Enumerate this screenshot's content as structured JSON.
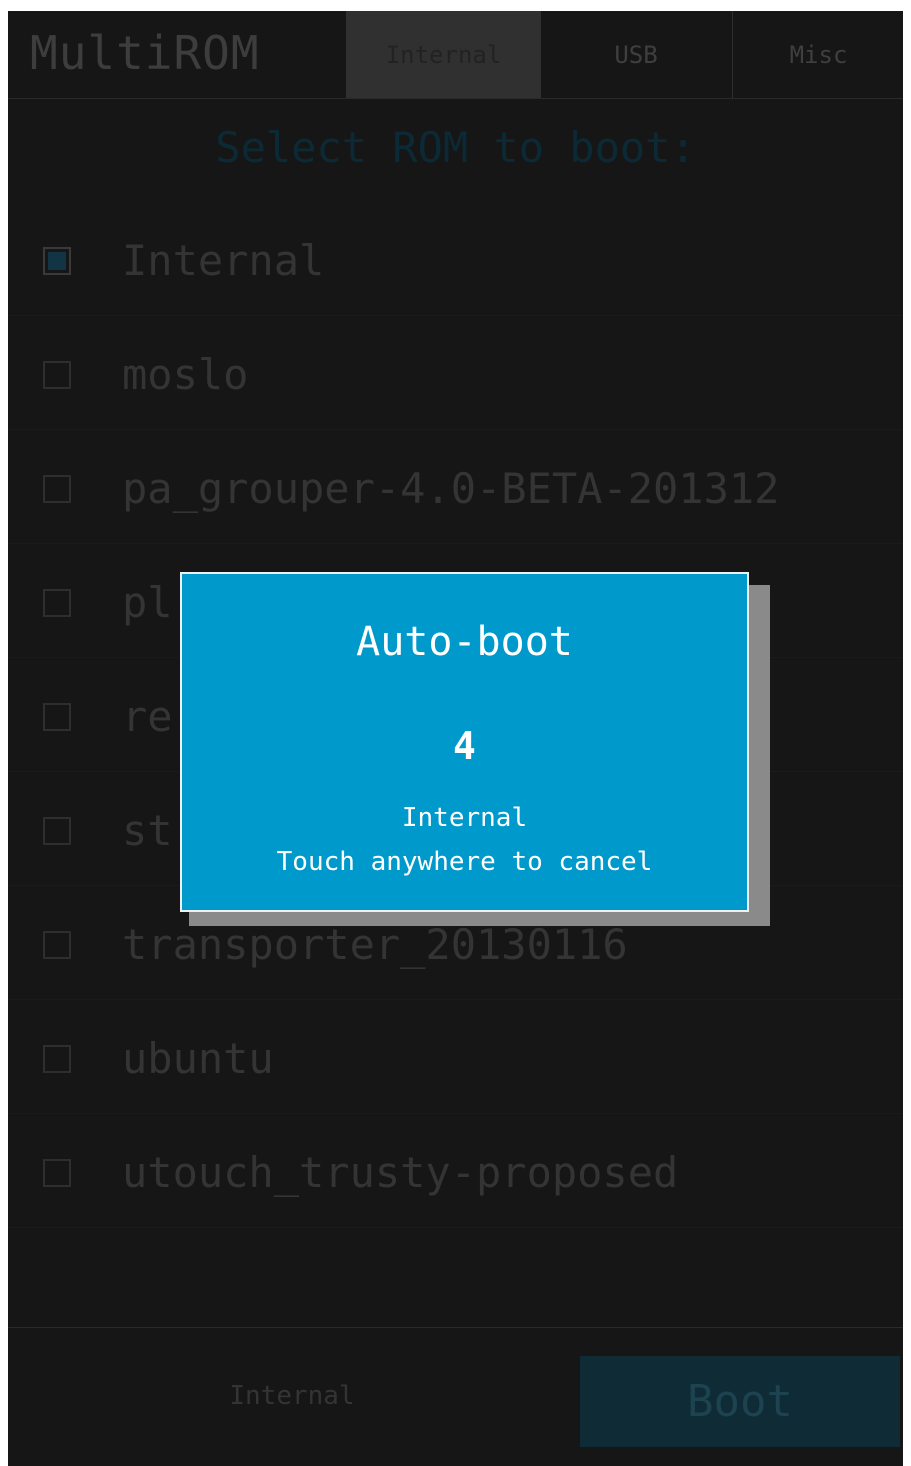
{
  "header": {
    "app_title": "MultiROM",
    "tabs": [
      {
        "label": "Internal",
        "active": true
      },
      {
        "label": "USB",
        "active": false
      },
      {
        "label": "Misc",
        "active": false
      }
    ]
  },
  "list": {
    "heading": "Select ROM to boot:",
    "roms": [
      {
        "label": "Internal",
        "checked": true
      },
      {
        "label": "moslo",
        "checked": false
      },
      {
        "label": "pa_grouper-4.0-BETA-201312",
        "checked": false
      },
      {
        "label": "pl",
        "checked": false
      },
      {
        "label": "re",
        "checked": false
      },
      {
        "label": "st",
        "checked": false
      },
      {
        "label": "transporter_20130116",
        "checked": false
      },
      {
        "label": "ubuntu",
        "checked": false
      },
      {
        "label": "utouch_trusty-proposed",
        "checked": false
      }
    ]
  },
  "footer": {
    "selected_rom": "Internal",
    "boot_label": "Boot"
  },
  "dialog": {
    "title": "Auto-boot",
    "countdown": "4",
    "rom": "Internal",
    "hint": "Touch anywhere to cancel"
  },
  "colors": {
    "screen_bg": "#161616",
    "dialog_bg": "#0099cc",
    "accent_dim": "#0f2b36"
  }
}
